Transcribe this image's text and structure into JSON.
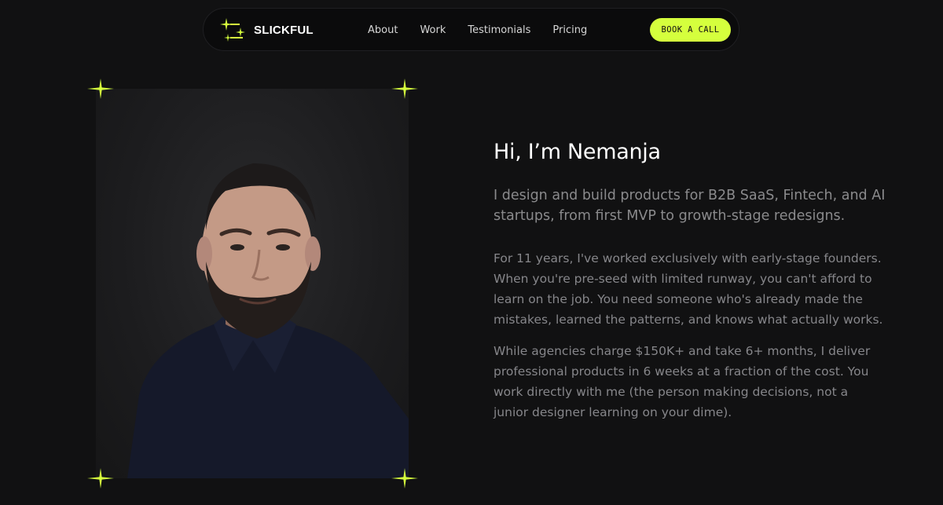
{
  "nav": {
    "brand": "SLICKFUL",
    "links": [
      {
        "label": "About"
      },
      {
        "label": "Work"
      },
      {
        "label": "Testimonials"
      },
      {
        "label": "Pricing"
      }
    ],
    "cta_label": "BOOK A CALL"
  },
  "hero": {
    "heading": "Hi, I’m Nemanja",
    "lead": "I design and build products for B2B SaaS, Fintech, and AI startups, from first MVP to growth-stage redesigns.",
    "paragraphs": [
      "For 11 years, I've worked exclusively with early-stage founders. When you're pre-seed with limited runway, you can't afford to learn on the job. You need someone who's already made the mistakes, learned the patterns, and knows what actually works.",
      "While agencies charge $150K+ and take 6+ months, I deliver professional products in 6 weeks at a fraction of the cost. You work directly with me (the person making decisions, not a junior designer learning on your dime)."
    ]
  },
  "colors": {
    "accent": "#d5ff3d",
    "background": "#111112",
    "nav_background": "#0b0b0c",
    "muted_text": "#8a8a8c"
  },
  "icons": {
    "logo": "sparkle-cluster-logo",
    "corner": "four-point-sparkle-icon"
  }
}
